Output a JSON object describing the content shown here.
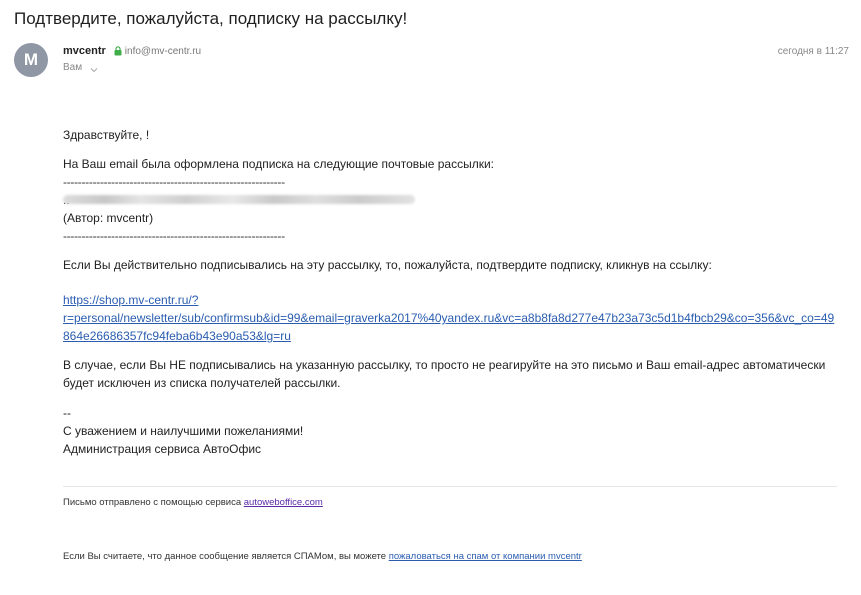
{
  "subject": "Подтвердите, пожалуйста, подписку на рассылку!",
  "avatar": {
    "letter": "M",
    "color": "#8f97a5"
  },
  "sender": {
    "name": "mvcentr",
    "email": "info@mv-centr.ru"
  },
  "recipient": {
    "label": "Вам"
  },
  "date": "сегодня в 11:27",
  "body": {
    "greeting": "Здравствуйте, !",
    "intro": "На Ваш email была оформлена подписка на следующие почтовые рассылки:",
    "divider": "------------------------------------------------------------",
    "list_prefix": "..",
    "author": "(Автор: mvcentr)",
    "instruction": "Если Вы действительно подписывались на эту рассылку, то, пожалуйста, подтвердите подписку, кликнув на ссылку:",
    "confirm_link": "https://shop.mv-centr.ru/?r=personal/newsletter/sub/confirmsub&id=99&email=graverka2017%40yandex.ru&vc=a8b8fa8d277e47b23a73c5d1b4fbcb29&co=356&vc_co=49864e26686357fc94feba6b43e90a53&lg=ru",
    "confirm_link_line1": "https://shop.mv-centr.ru/?",
    "confirm_link_line2": "r=personal/newsletter/sub/confirmsub&id=99&email=graverka2017%40yandex.ru&vc=a8b8fa8d277e47b23a73c5d1b4fbcb29&co=356&vc_co=49",
    "confirm_link_line3": "864e26686357fc94feba6b43e90a53&lg=ru",
    "warning_line1": "В случае, если Вы НЕ подписывались на указанную рассылку, то просто не реагируйте на это письмо и Ваш email-адрес автоматически",
    "warning_line2": "будет исключен из списка получателей рассылки.",
    "sig_dash": "--",
    "sig_regards": "С уважением и наилучшими пожеланиями!",
    "sig_admin": "Администрация сервиса АвтоОфис"
  },
  "footer": {
    "sent_via_text": "Письмо отправлено с помощью сервиса ",
    "sent_via_link": "autoweboffice.com",
    "spam_text": "Если Вы считаете, что данное сообщение является СПАМом, вы можете ",
    "spam_link": "пожаловаться на спам от компании mvcentr"
  },
  "colors": {
    "link": "#2a5db0",
    "footer_link": "#5a2aa8",
    "lock": "#3fae49"
  }
}
